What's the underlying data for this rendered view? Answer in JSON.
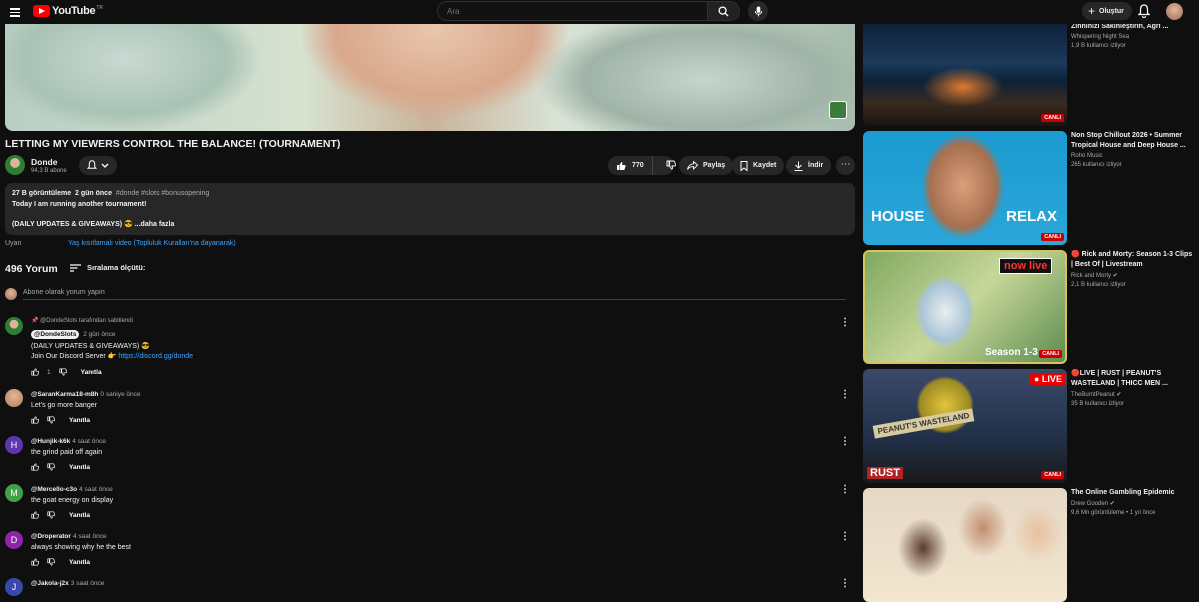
{
  "header": {
    "logo_text": "YouTube",
    "region": "TR",
    "search_placeholder": "Ara",
    "create_label": "Oluştur"
  },
  "video": {
    "title": "LETTING MY VIEWERS CONTROL THE BALANCE! (TOURNAMENT)",
    "channel": "Donde",
    "subscribers": "94,3 B abone",
    "likes": "770",
    "share": "Paylaş",
    "save": "Kaydet",
    "download": "İndir"
  },
  "description": {
    "views": "27 B görüntüleme",
    "date": "2 gün önce",
    "tags": "#donde #slots #bonusopening",
    "line1": "Today I am running another tournament!",
    "line2": "(DAILY UPDATES & GIVEAWAYS) 😎",
    "more": "...daha fazla"
  },
  "warning": {
    "label": "Uyarı",
    "link": "Yaş kısıtlamalı video (Topluluk Kuralları'na dayanarak)"
  },
  "comments": {
    "count": "496 Yorum",
    "sort_label": "Sıralama ölçütü:",
    "add_placeholder": "Abone olarak yorum yapın",
    "reply_label": "Yanıtla",
    "pinned": {
      "pinned_by": "@DondeSlots tarafından sabitlendi",
      "author": "@DondeSlots",
      "time": "2 gün önce",
      "line1": "(DAILY UPDATES & GIVEAWAYS) 😎",
      "line2": "Join Our Discord Server 👉",
      "link": "https://discord.gg/donde",
      "likes": "1"
    },
    "items": [
      {
        "author": "@SaranKarma18-m8h",
        "time": "0 saniye önce",
        "text": "Let's go more banger",
        "initial": "",
        "color": "#b07a60"
      },
      {
        "author": "@Hunjik-k6k",
        "time": "4 saat önce",
        "text": "the grind paid off again",
        "initial": "H",
        "color": "#5e35b1"
      },
      {
        "author": "@Mercello-c3o",
        "time": "4 saat önce",
        "text": "the goat energy on display",
        "initial": "M",
        "color": "#43a047"
      },
      {
        "author": "@Droperator",
        "time": "4 saat önce",
        "text": "always showing why he the best",
        "initial": "D",
        "color": "#8e24aa"
      },
      {
        "author": "@Jakola-j2x",
        "time": "3 saat önce",
        "text": "",
        "initial": "J",
        "color": "#3949ab"
      }
    ]
  },
  "sidebar": [
    {
      "title": "Zihninizi Sakinleştirin, Ağrı ...",
      "channel": "Whispering Night Sea",
      "views": "1,9 B kullanıcı izliyor",
      "badge": "CANLI"
    },
    {
      "title": "Non Stop Chillout 2026 • Summer Tropical House and Deep House ...",
      "channel": "Roho Music",
      "views": "265 kullanıcı izliyor",
      "badge": "CANLI",
      "thumb_left": "HOUSE",
      "thumb_right": "RELAX"
    },
    {
      "title": "🔴 Rick and Morty: Season 1-3 Clips | Best Of | Livestream",
      "channel": "Rick and Morty",
      "views": "2,1 B kullanıcı izliyor",
      "badge": "CANLI",
      "thumb_tag": "now live",
      "thumb_season": "Season 1-3"
    },
    {
      "title": "🔴LIVE | RUST | PEANUT'S WASTELAND | THICC MEN ...",
      "channel": "TheBurntPeanut",
      "views": "35 B kullanıcı izliyor",
      "badge": "CANLI",
      "thumb_live": "● LIVE",
      "thumb_rust": "RUST",
      "thumb_wasteland": "PEANUT'S WASTELAND"
    },
    {
      "title": "The Online Gambling Epidemic",
      "channel": "Drew Gooden",
      "views": "9,6 Mn görüntüleme • 1 yıl önce"
    }
  ]
}
